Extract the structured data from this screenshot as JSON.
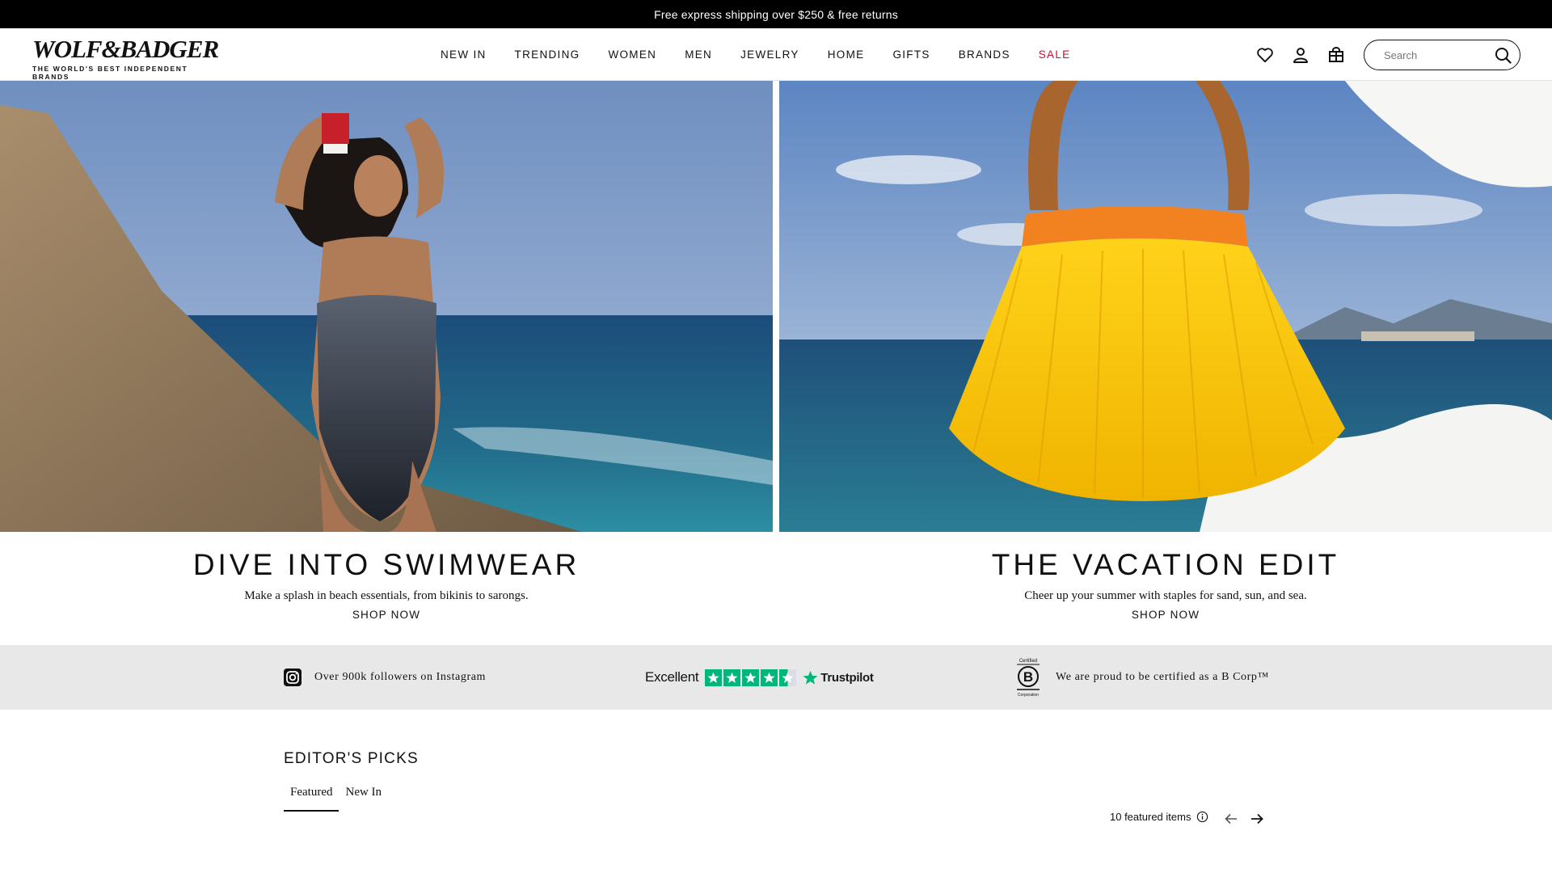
{
  "announcement": {
    "text": "Free express shipping over $250 & free returns"
  },
  "header": {
    "logo_text": "WOLF&BADGER",
    "logo_tagline": "THE WORLD'S BEST INDEPENDENT BRANDS",
    "nav": [
      {
        "label": "NEW IN"
      },
      {
        "label": "TRENDING"
      },
      {
        "label": "WOMEN"
      },
      {
        "label": "MEN"
      },
      {
        "label": "JEWELRY"
      },
      {
        "label": "HOME"
      },
      {
        "label": "GIFTS"
      },
      {
        "label": "BRANDS"
      },
      {
        "label": "SALE",
        "color": "#c8102e"
      }
    ],
    "icons": [
      "heart-icon",
      "user-icon",
      "bag-icon"
    ],
    "search": {
      "placeholder": "Search",
      "value": ""
    }
  },
  "heroes": [
    {
      "title": "DIVE INTO SWIMWEAR",
      "subtitle": "Make a splash in beach essentials, from bikinis to sarongs.",
      "cta": "SHOP NOW"
    },
    {
      "title": "THE VACATION EDIT",
      "subtitle": "Cheer up your summer with staples for sand, sun, and sea.",
      "cta": "SHOP NOW"
    }
  ],
  "trust": {
    "instagram": "Over 900k followers on Instagram",
    "trustpilot_rating": "Excellent",
    "trustpilot_stars": 4.5,
    "trustpilot_brand": "Trustpilot",
    "bcorp_top": "Certified",
    "bcorp_bottom": "Corporation",
    "bcorp": "We are proud to be certified as a B Corp™"
  },
  "editors_picks": {
    "title": "EDITOR'S PICKS",
    "tabs": [
      {
        "label": "Featured",
        "active": true
      },
      {
        "label": "New In",
        "active": false
      }
    ],
    "count_label": "10 featured items"
  },
  "colors": {
    "announcement_bg": "#000000",
    "sale": "#c8102e",
    "trust_band": "#e8e8e8",
    "trustpilot_green": "#00b67a"
  }
}
